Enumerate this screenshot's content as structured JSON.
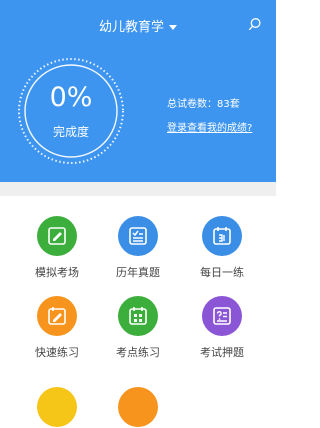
{
  "header": {
    "title": "幼儿教育学"
  },
  "progress": {
    "percent_text": "0%",
    "label": "完成度",
    "value": 0
  },
  "stats": {
    "count_text": "总试卷数：83套",
    "login_link": "登录查看我的成绩?"
  },
  "grid": [
    {
      "label": "模拟考场",
      "color": "#3cae3c",
      "icon": "edit-icon"
    },
    {
      "label": "历年真题",
      "color": "#3a8ee6",
      "icon": "checklist-icon"
    },
    {
      "label": "每日一练",
      "color": "#3a8ee6",
      "icon": "calendar-icon"
    },
    {
      "label": "快速练习",
      "color": "#f7941d",
      "icon": "quick-edit-icon"
    },
    {
      "label": "考点练习",
      "color": "#3cae3c",
      "icon": "grid-calendar-icon"
    },
    {
      "label": "考试押题",
      "color": "#8a56d6",
      "icon": "question-list-icon"
    }
  ],
  "more_colors": [
    "#f5c518",
    "#f7941d"
  ]
}
